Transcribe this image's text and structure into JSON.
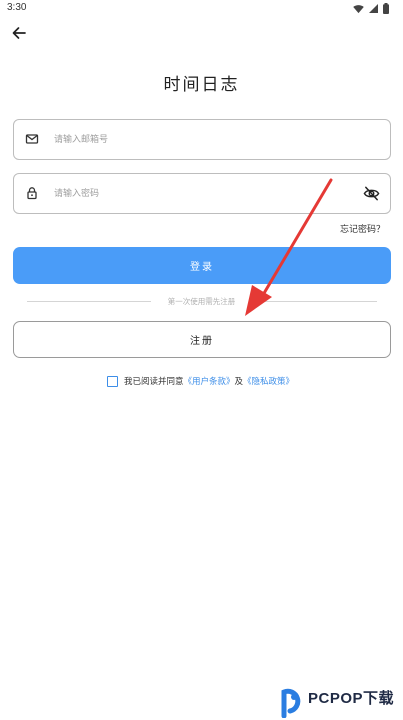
{
  "status_bar": {
    "time": "3:30"
  },
  "header": {
    "title": "时间日志"
  },
  "form": {
    "email": {
      "placeholder": "请输入邮箱号",
      "value": ""
    },
    "password": {
      "placeholder": "请输入密码",
      "value": ""
    },
    "forgot_label": "忘记密码？",
    "login_label": "登录",
    "divider_label": "第一次使用需先注册",
    "register_label": "注册"
  },
  "agreement": {
    "prefix": "我已阅读并同意",
    "terms_link": "《用户条款》",
    "and": "及",
    "privacy_link": "《隐私政策》",
    "checked": false
  },
  "watermark": {
    "brand": "PCPOP下载"
  },
  "colors": {
    "primary": "#4a9cf8",
    "link": "#3d8ee8",
    "annotation_arrow": "#e53935",
    "border": "#bdbdbd"
  },
  "icons": {
    "back": "arrow-left-icon",
    "email": "mail-icon",
    "password": "lock-icon",
    "visibility": "eye-off-icon"
  }
}
